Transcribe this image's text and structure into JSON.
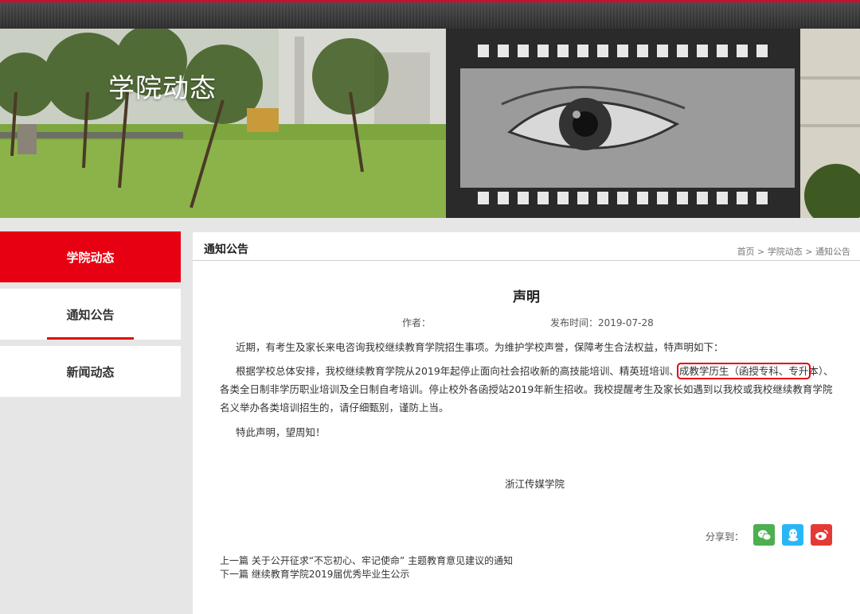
{
  "banner": {
    "title": "学院动态"
  },
  "sidebar": {
    "items": [
      {
        "label": "学院动态"
      },
      {
        "label": "通知公告"
      },
      {
        "label": "新闻动态"
      }
    ]
  },
  "main": {
    "section_title": "通知公告",
    "breadcrumb": [
      "首页",
      "学院动态",
      "通知公告"
    ],
    "breadcrumb_sep": " > ",
    "article": {
      "title": "声明",
      "author_label": "作者：",
      "publish_label": "发布时间：",
      "publish_date": "2019-07-28",
      "paragraphs": {
        "p1": "近期，有考生及家长来电咨询我校继续教育学院招生事项。为维护学校声誉，保障考生合法权益，特声明如下：",
        "p2_before": "根据学校总体安排，我校继续教育学院从2019年起停止面向社会招收新的高技能培训、精英班培训、",
        "p2_highlight": "成教学历生（函授专科、专升",
        "p2_after": "本）、各类全日制非学历职业培训及全日制自考培训。停止校外各函授站2019年新生招收。我校提醒考生及家长如遇到以我校或我校继续教育学院名义举办各类培训招生的，请仔细甄别，谨防上当。",
        "p3": "特此声明，望周知！"
      },
      "signature": "浙江传媒学院"
    },
    "share_label": "分享到：",
    "share_icons": [
      "wechat-icon",
      "qq-icon",
      "weibo-icon"
    ],
    "prev": {
      "label": "上一篇",
      "title": "关于公开征求“不忘初心、牢记使命” 主题教育意见建议的通知"
    },
    "next": {
      "label": "下一篇",
      "title": "继续教育学院2019届优秀毕业生公示"
    }
  },
  "colors": {
    "accent": "#e60012",
    "wechat": "#4caf50",
    "qq": "#29b6f6",
    "weibo": "#e53935"
  }
}
